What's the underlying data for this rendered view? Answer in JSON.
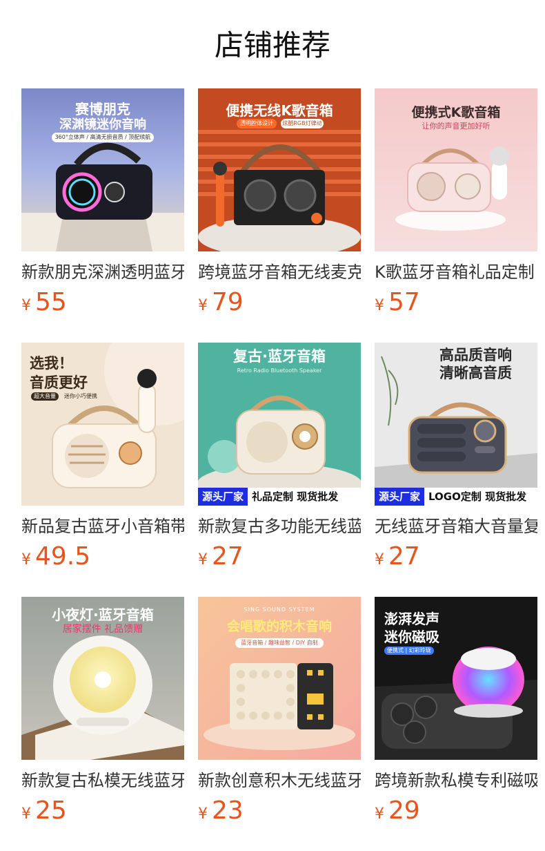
{
  "header": {
    "title": "店铺推荐"
  },
  "currency_symbol": "¥",
  "accent_color": "#e8541e",
  "products": [
    {
      "name": "新款朋克深渊透明蓝牙音箱",
      "price": "55",
      "image_text": {
        "line1": "赛博朋克",
        "line2": "深渊镜迷你音响",
        "line3": "360°立体声 / 高清无损音质 / 顶配续航"
      }
    },
    {
      "name": "跨境蓝牙音箱无线麦克风",
      "price": "79",
      "image_text": {
        "line1": "便携无线K歌音箱",
        "line2": "透明腔体设计",
        "line3": "炫酷RGB灯律动"
      }
    },
    {
      "name": "K歌蓝牙音箱礼品定制",
      "price": "57",
      "image_text": {
        "line1": "便携式K歌音箱",
        "line2": "让你的声音更加好听"
      }
    },
    {
      "name": "新品复古蓝牙小音箱带麦",
      "price": "49.5",
      "image_text": {
        "line1": "选我！",
        "line2": "音质更好",
        "line3": "超大音量",
        "line4": "迷你小巧便携"
      }
    },
    {
      "name": "新款复古多功能无线蓝牙音箱",
      "price": "27",
      "image_text": {
        "line1": "复古·蓝牙音箱",
        "line2": "Retro Radio Bluetooth Speaker",
        "banner_a": "源头厂家",
        "banner_b": "礼品定制 现货批发"
      }
    },
    {
      "name": "无线蓝牙音箱大音量复古",
      "price": "27",
      "image_text": {
        "line1": "高品质音响",
        "line2": "清晰高音质",
        "banner_a": "源头厂家",
        "banner_b": "LOGO定制 现货批发"
      }
    },
    {
      "name": "新款复古私模无线蓝牙音箱",
      "price": "25",
      "image_text": {
        "line1": "小夜灯·蓝牙音箱",
        "line2": "居家摆件 礼品馈赠"
      }
    },
    {
      "name": "新款创意积木无线蓝牙音箱",
      "price": "23",
      "image_text": {
        "line1": "SING SOUND SYSTEM",
        "line2": "会唱歌的积木音响",
        "line3": "蓝牙音箱 / 趣味益智 / DIY 自制"
      }
    },
    {
      "name": "跨境新款私模专利磁吸音箱",
      "price": "29",
      "image_text": {
        "line1": "澎湃发声",
        "line2": "迷你磁吸",
        "line3": "便携式 | 幻彩玲珑"
      }
    }
  ]
}
